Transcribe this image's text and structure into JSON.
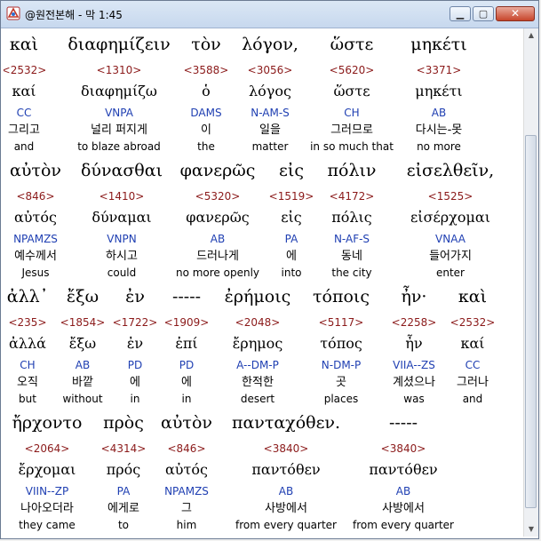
{
  "window": {
    "title": "@원전본해 - 막 1:45",
    "minimize": "▁",
    "maximize": "▢",
    "close": "✕"
  },
  "rows": [
    {
      "segments": [
        {
          "greek": "καὶ",
          "strong": "<2532>",
          "lemma": "καί",
          "parse": "CC",
          "korean": "그리고",
          "english": "and"
        },
        {
          "greek": "διαφημίζειν",
          "strong": "<1310>",
          "lemma": "διαφημίζω",
          "parse": "VNPA",
          "korean": "널리 퍼지게",
          "english": "to blaze abroad"
        },
        {
          "greek": "τὸν",
          "strong": "<3588>",
          "lemma": "ὁ",
          "parse": "DAMS",
          "korean": "이",
          "english": "the"
        },
        {
          "greek": "λόγον,",
          "strong": "<3056>",
          "lemma": "λόγος",
          "parse": "N-AM-S",
          "korean": "일을",
          "english": "matter"
        },
        {
          "greek": "ὥστε",
          "strong": "<5620>",
          "lemma": "ὥστε",
          "parse": "CH",
          "korean": "그러므로",
          "english": "in so much that"
        },
        {
          "greek": "μηκέτι",
          "strong": "<3371>",
          "lemma": "μηκέτι",
          "parse": "AB",
          "korean": "다시는-못",
          "english": "no more"
        }
      ]
    },
    {
      "segments": [
        {
          "greek": "αὐτὸν",
          "strong": "<846>",
          "lemma": "αὐτός",
          "parse": "NPAMZS",
          "korean": "예수께서",
          "english": "Jesus"
        },
        {
          "greek": "δύνασθαι",
          "strong": "<1410>",
          "lemma": "δύναμαι",
          "parse": "VNPN",
          "korean": "하시고",
          "english": "could"
        },
        {
          "greek": "φανερῶς",
          "strong": "<5320>",
          "lemma": "φανερῶς",
          "parse": "AB",
          "korean": "드러나게",
          "english": "no more openly"
        },
        {
          "greek": "εἰς",
          "strong": "<1519>",
          "lemma": "εἰς",
          "parse": "PA",
          "korean": "에",
          "english": "into"
        },
        {
          "greek": "πόλιν",
          "strong": "<4172>",
          "lemma": "πόλις",
          "parse": "N-AF-S",
          "korean": "동네",
          "english": "the city"
        },
        {
          "greek": "εἰσελθεῖν,",
          "strong": "<1525>",
          "lemma": "εἰσέρχομαι",
          "parse": "VNAA",
          "korean": "들어가지",
          "english": "enter"
        }
      ]
    },
    {
      "segments": [
        {
          "greek": "ἀλλ᾽",
          "strong": "<235>",
          "lemma": "ἀλλά",
          "parse": "CH",
          "korean": "오직",
          "english": "but"
        },
        {
          "greek": "ἔξω",
          "strong": "<1854>",
          "lemma": "ἔξω",
          "parse": "AB",
          "korean": "바깥",
          "english": "without"
        },
        {
          "greek": "ἐν",
          "strong": "<1722>",
          "lemma": "ἐν",
          "parse": "PD",
          "korean": "에",
          "english": "in"
        },
        {
          "greek": "-----",
          "strong": "<1909>",
          "lemma": "ἐπί",
          "parse": "PD",
          "korean": "에",
          "english": "in"
        },
        {
          "greek": "ἐρήμοις",
          "strong": "<2048>",
          "lemma": "ἔρημος",
          "parse": "A--DM-P",
          "korean": "한적한",
          "english": "desert"
        },
        {
          "greek": "τόποις",
          "strong": "<5117>",
          "lemma": "τόπος",
          "parse": "N-DM-P",
          "korean": "곳",
          "english": "places"
        },
        {
          "greek": "ἦν·",
          "strong": "<2258>",
          "lemma": "ἦν",
          "parse": "VIIA--ZS",
          "korean": "계셨으나",
          "english": "was"
        },
        {
          "greek": "καὶ",
          "strong": "<2532>",
          "lemma": "καί",
          "parse": "CC",
          "korean": "그러나",
          "english": "and"
        }
      ]
    },
    {
      "segments": [
        {
          "greek": "ἤρχοντο",
          "strong": "<2064>",
          "lemma": "ἔρχομαι",
          "parse": "VIIN--ZP",
          "korean": "나아오더라",
          "english": "they came"
        },
        {
          "greek": "πρὸς",
          "strong": "<4314>",
          "lemma": "πρός",
          "parse": "PA",
          "korean": "에게로",
          "english": "to"
        },
        {
          "greek": "αὐτὸν",
          "strong": "<846>",
          "lemma": "αὐτός",
          "parse": "NPAMZS",
          "korean": "그",
          "english": "him"
        },
        {
          "greek": "πανταχόθεν.",
          "strong": "<3840>",
          "lemma": "παντόθεν",
          "parse": "AB",
          "korean": "사방에서",
          "english": "from every quarter"
        },
        {
          "greek": "-----",
          "strong": "<3840>",
          "lemma": "παντόθεν",
          "parse": "AB",
          "korean": "사방에서",
          "english": "from every quarter"
        }
      ]
    }
  ]
}
